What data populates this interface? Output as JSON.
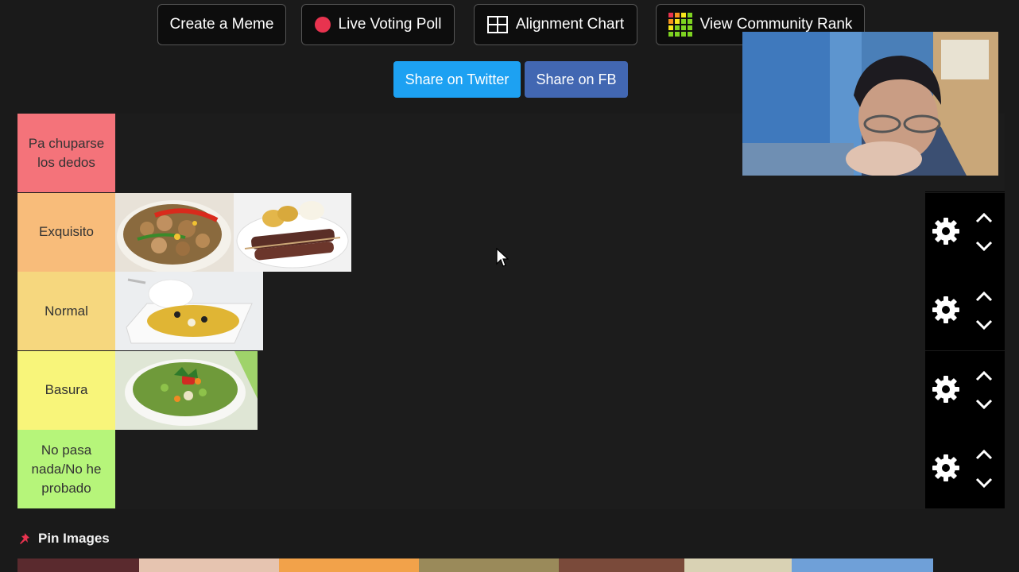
{
  "toolbar": {
    "create_meme": "Create a Meme",
    "live_poll": "Live Voting Poll",
    "alignment_chart": "Alignment Chart",
    "community_rank": "View Community Rank"
  },
  "share": {
    "twitter": "Share on Twitter",
    "facebook": "Share on FB",
    "twitter_color": "#1da1f2",
    "facebook_color": "#4267b2"
  },
  "tiers": [
    {
      "label": "Pa chuparse los dedos",
      "color": "#f4737a"
    },
    {
      "label": "Exquisito",
      "color": "#f8bc7a"
    },
    {
      "label": "Normal",
      "color": "#f6d77e"
    },
    {
      "label": "Basura",
      "color": "#f8f57a"
    },
    {
      "label": "No pasa nada/No he probado",
      "color": "#b6f57a"
    }
  ],
  "tier_items": {
    "exquisito": [
      "lomo-saltado-image",
      "anticuchos-image"
    ],
    "normal": [
      "aji-de-gallina-image"
    ],
    "basura": [
      "soup-image"
    ]
  },
  "pin": {
    "label": "Pin Images",
    "icon": "pin-icon"
  }
}
